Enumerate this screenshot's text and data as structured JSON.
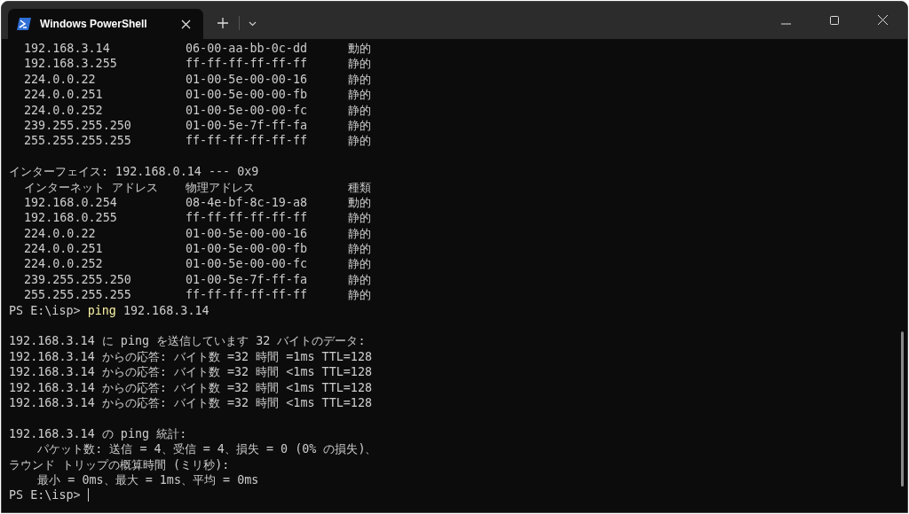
{
  "window": {
    "tab": {
      "title": "Windows PowerShell",
      "selected": true
    }
  },
  "lines": [
    {
      "kind": "row",
      "cells": [
        "192.168.3.14",
        "06-00-aa-bb-0c-dd",
        "動的"
      ]
    },
    {
      "kind": "row",
      "cells": [
        "192.168.3.255",
        "ff-ff-ff-ff-ff-ff",
        "静的"
      ]
    },
    {
      "kind": "row",
      "cells": [
        "224.0.0.22",
        "01-00-5e-00-00-16",
        "静的"
      ]
    },
    {
      "kind": "row",
      "cells": [
        "224.0.0.251",
        "01-00-5e-00-00-fb",
        "静的"
      ]
    },
    {
      "kind": "row",
      "cells": [
        "224.0.0.252",
        "01-00-5e-00-00-fc",
        "静的"
      ]
    },
    {
      "kind": "row",
      "cells": [
        "239.255.255.250",
        "01-00-5e-7f-ff-fa",
        "静的"
      ]
    },
    {
      "kind": "row",
      "cells": [
        "255.255.255.255",
        "ff-ff-ff-ff-ff-ff",
        "静的"
      ]
    },
    {
      "kind": "blank"
    },
    {
      "kind": "text",
      "text": "インターフェイス: 192.168.0.14 --- 0x9"
    },
    {
      "kind": "row",
      "cells": [
        "インターネット アドレス",
        "物理アドレス",
        "種類"
      ]
    },
    {
      "kind": "row",
      "cells": [
        "192.168.0.254",
        "08-4e-bf-8c-19-a8",
        "動的"
      ]
    },
    {
      "kind": "row",
      "cells": [
        "192.168.0.255",
        "ff-ff-ff-ff-ff-ff",
        "静的"
      ]
    },
    {
      "kind": "row",
      "cells": [
        "224.0.0.22",
        "01-00-5e-00-00-16",
        "静的"
      ]
    },
    {
      "kind": "row",
      "cells": [
        "224.0.0.251",
        "01-00-5e-00-00-fb",
        "静的"
      ]
    },
    {
      "kind": "row",
      "cells": [
        "224.0.0.252",
        "01-00-5e-00-00-fc",
        "静的"
      ]
    },
    {
      "kind": "row",
      "cells": [
        "239.255.255.250",
        "01-00-5e-7f-ff-fa",
        "静的"
      ]
    },
    {
      "kind": "row",
      "cells": [
        "255.255.255.255",
        "ff-ff-ff-ff-ff-ff",
        "静的"
      ]
    },
    {
      "kind": "prompt",
      "prompt": "PS E:\\isp>",
      "command": "ping",
      "args": "192.168.3.14",
      "cursor": false
    },
    {
      "kind": "blank"
    },
    {
      "kind": "text",
      "text": "192.168.3.14 に ping を送信しています 32 バイトのデータ:"
    },
    {
      "kind": "text",
      "text": "192.168.3.14 からの応答: バイト数 =32 時間 =1ms TTL=128"
    },
    {
      "kind": "text",
      "text": "192.168.3.14 からの応答: バイト数 =32 時間 <1ms TTL=128"
    },
    {
      "kind": "text",
      "text": "192.168.3.14 からの応答: バイト数 =32 時間 <1ms TTL=128"
    },
    {
      "kind": "text",
      "text": "192.168.3.14 からの応答: バイト数 =32 時間 <1ms TTL=128"
    },
    {
      "kind": "blank"
    },
    {
      "kind": "text",
      "text": "192.168.3.14 の ping 統計:"
    },
    {
      "kind": "text",
      "text": "    パケット数: 送信 = 4、受信 = 4、損失 = 0 (0% の損失)、"
    },
    {
      "kind": "text",
      "text": "ラウンド トリップの概算時間 (ミリ秒):"
    },
    {
      "kind": "text",
      "text": "    最小 = 0ms、最大 = 1ms、平均 = 0ms"
    },
    {
      "kind": "prompt",
      "prompt": "PS E:\\isp>",
      "cursor": true
    }
  ]
}
